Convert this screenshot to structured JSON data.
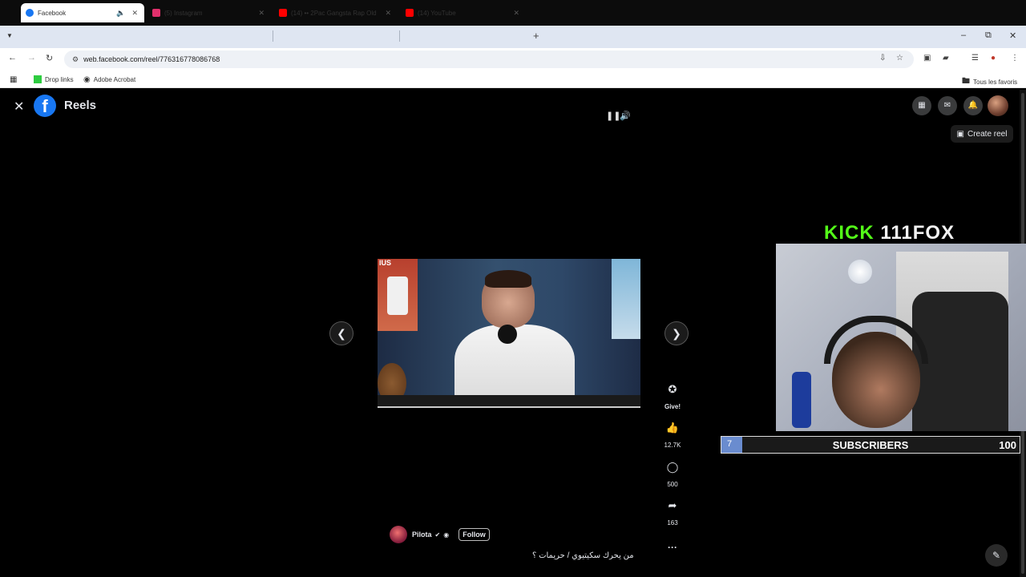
{
  "browser": {
    "tabs": [
      {
        "title": "Facebook",
        "active": true,
        "favicon_color": "#1877f2"
      },
      {
        "title": "(5) Instagram",
        "active": false,
        "favicon_color": "#e1306c"
      },
      {
        "title": "(14) •• 2Pac Gangsta Rap Old",
        "active": false,
        "favicon_color": "#ff0000"
      },
      {
        "title": "(14) YouTube",
        "active": false,
        "favicon_color": "#ff0000"
      }
    ],
    "url": "web.facebook.com/reel/776316778086768",
    "bookmarks": [
      {
        "label": "Drop links"
      },
      {
        "label": "Adobe Acrobat"
      }
    ],
    "all_bookmarks_label": "Tous les favoris"
  },
  "facebook": {
    "section_title": "Reels",
    "create_reel_label": "Create reel",
    "actions": {
      "give_label": "Give!",
      "likes": "12.7K",
      "comments": "500",
      "shares": "163"
    },
    "author_name": "Pilota",
    "follow_label": "Follow",
    "caption": "من يحرك سكيتيوي / حريمات ؟",
    "poster_text": "IUS"
  },
  "overlay": {
    "kick_prefix": "KICK",
    "channel": "111FOX",
    "subscribers_label": "SUBSCRIBERS",
    "subscribers_current": "7",
    "subscribers_goal": "100",
    "subscribers_fraction": 0.07,
    "kick_color": "#53fc18"
  }
}
